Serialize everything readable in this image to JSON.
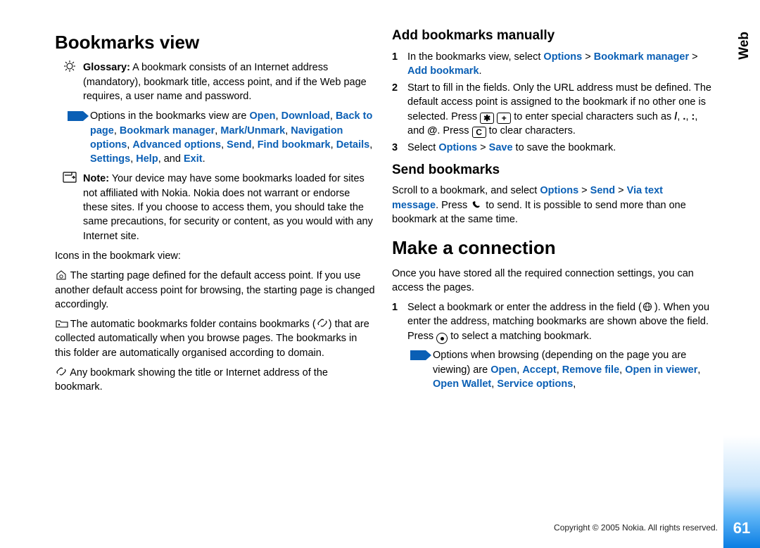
{
  "sidetab": "Web",
  "pagenum": "61",
  "copyright": "Copyright © 2005 Nokia. All rights reserved.",
  "left": {
    "h1": "Bookmarks view",
    "glossary_label": "Glossary:",
    "glossary_body": " A bookmark consists of an Internet address (mandatory), bookmark title, access point, and if the Web page requires, a user name and password.",
    "options_intro": "Options in the bookmarks view are ",
    "opt1": "Open",
    "opt2": "Download",
    "opt3": "Back to page",
    "opt4": "Bookmark manager",
    "opt5": "Mark/Unmark",
    "opt6": "Navigation options",
    "opt7": "Advanced options",
    "opt8": "Send",
    "opt9": "Find bookmark",
    "opt10": "Details",
    "opt11": "Settings",
    "opt12": "Help",
    "opt_and": ", and ",
    "opt13": "Exit",
    "note_label": "Note:",
    "note_body": " Your device may have some bookmarks loaded for sites not affiliated with Nokia. Nokia does not warrant or endorse these sites. If you choose to access them, you should take the same precautions, for security or content, as you would with any Internet site.",
    "icons_heading": "Icons in the bookmark view:",
    "icon1_body": " The starting page defined for the default access point. If you use another default access point for browsing, the starting page is changed accordingly.",
    "icon2_pre": " The automatic bookmarks folder contains bookmarks (",
    "icon2_post": ") that are collected automatically when you browse pages. The bookmarks in this folder are automatically organised according to domain.",
    "icon3_body": " Any bookmark showing the title or Internet address of the bookmark."
  },
  "right": {
    "h2a": "Add bookmarks manually",
    "s1_pre": "In the bookmarks view, select ",
    "s1_b1": "Options",
    "s1_gt1": " > ",
    "s1_b2": "Bookmark manager",
    "s1_gt2": " > ",
    "s1_b3": "Add bookmark",
    "s1_post": ".",
    "s2_a": "Start to fill in the fields. Only the URL address must be defined. The default access point is assigned to the bookmark if no other one is selected. Press ",
    "s2_b": " to enter special characters such as ",
    "s2_c1": "/",
    "s2_c2": ".",
    "s2_c3": ":",
    "s2_c4": "@",
    "s2_d": ". Press ",
    "s2_e": " to clear characters.",
    "s3_pre": "Select ",
    "s3_b1": "Options",
    "s3_gt": " > ",
    "s3_b2": "Save",
    "s3_post": " to save the bookmark.",
    "h2b": "Send bookmarks",
    "send_a": "Scroll to a bookmark, and select ",
    "send_b1": "Options",
    "send_gt1": " > ",
    "send_b2": "Send",
    "send_gt2": " > ",
    "send_b3": "Via text message",
    "send_c": ". Press ",
    "send_d": " to send. It is possible to send more than one bookmark at the same time.",
    "h1b": "Make a connection",
    "conn_intro": "Once you have stored all the required connection settings, you can access the pages.",
    "c1_a": "Select a bookmark or enter the address in the field (",
    "c1_b": "). When you enter the address, matching bookmarks are shown above the field. Press ",
    "c1_c": " to select a matching bookmark.",
    "browse_intro": "Options when browsing (depending on the page you are viewing) are ",
    "br1": "Open",
    "br2": "Accept",
    "br3": "Remove file",
    "br4": "Open in viewer",
    "br5": "Open Wallet",
    "br6": "Service options",
    "comma": ", "
  }
}
